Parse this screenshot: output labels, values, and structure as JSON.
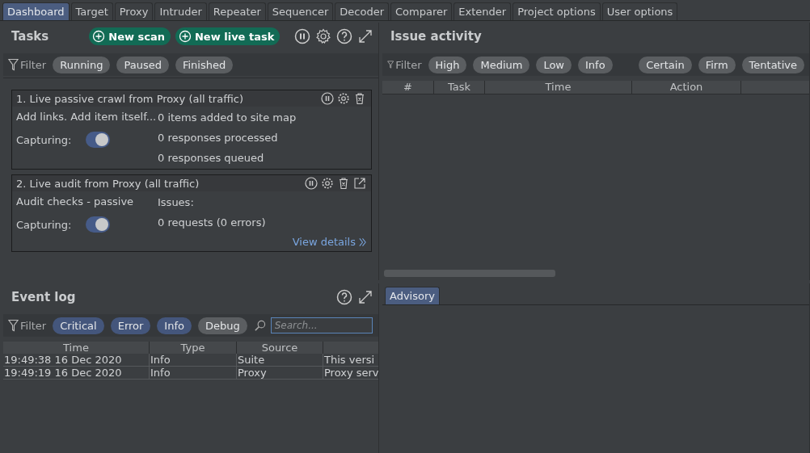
{
  "tabs": [
    {
      "label": "Dashboard",
      "selected": true
    },
    {
      "label": "Target",
      "selected": false
    },
    {
      "label": "Proxy",
      "selected": false
    },
    {
      "label": "Intruder",
      "selected": false
    },
    {
      "label": "Repeater",
      "selected": false
    },
    {
      "label": "Sequencer",
      "selected": false
    },
    {
      "label": "Decoder",
      "selected": false
    },
    {
      "label": "Comparer",
      "selected": false
    },
    {
      "label": "Extender",
      "selected": false
    },
    {
      "label": "Project options",
      "selected": false
    },
    {
      "label": "User options",
      "selected": false
    }
  ],
  "tasks": {
    "title": "Tasks",
    "buttons": [
      "New scan",
      "New live task"
    ],
    "filter_label": "Filter",
    "filters": [
      {
        "label": "Running",
        "selected": false
      },
      {
        "label": "Paused",
        "selected": false
      },
      {
        "label": "Finished",
        "selected": false
      }
    ],
    "items": [
      {
        "title": "1. Live passive crawl from Proxy (all traffic)",
        "description": "Add links. Add item itself...",
        "capturing_label": "Capturing:",
        "capturing": true,
        "stats": [
          "0 items added to site map",
          "0 responses processed",
          "0 responses queued"
        ],
        "popout": false
      },
      {
        "title": "2. Live audit from Proxy (all traffic)",
        "description": "Audit checks - passive",
        "capturing_label": "Capturing:",
        "capturing": true,
        "stats": [
          "Issues:",
          "0 requests (0 errors)"
        ],
        "popout": true,
        "link": "View details"
      }
    ]
  },
  "issue_activity": {
    "title": "Issue activity",
    "filter_label": "Filter",
    "severity_filters": [
      {
        "label": "High",
        "selected": false
      },
      {
        "label": "Medium",
        "selected": false
      },
      {
        "label": "Low",
        "selected": false
      },
      {
        "label": "Info",
        "selected": false
      }
    ],
    "confidence_filters": [
      {
        "label": "Certain",
        "selected": false
      },
      {
        "label": "Firm",
        "selected": false
      },
      {
        "label": "Tentative",
        "selected": false
      }
    ],
    "columns": [
      "#",
      "Task",
      "Time",
      "Action"
    ]
  },
  "event_log": {
    "title": "Event log",
    "filter_label": "Filter",
    "filters": [
      {
        "label": "Critical",
        "selected": true
      },
      {
        "label": "Error",
        "selected": true
      },
      {
        "label": "Info",
        "selected": true
      },
      {
        "label": "Debug",
        "selected": false
      }
    ],
    "search": {
      "placeholder": "Search..."
    },
    "columns": [
      "Time",
      "Type",
      "Source"
    ],
    "rows": [
      [
        "19:49:38 16 Dec 2020",
        "Info",
        "Suite",
        "This versi"
      ],
      [
        "19:49:19 16 Dec 2020",
        "Info",
        "Proxy",
        "Proxy serv"
      ]
    ]
  },
  "advisory": {
    "tabs": [
      {
        "label": "Advisory",
        "selected": true
      }
    ]
  }
}
